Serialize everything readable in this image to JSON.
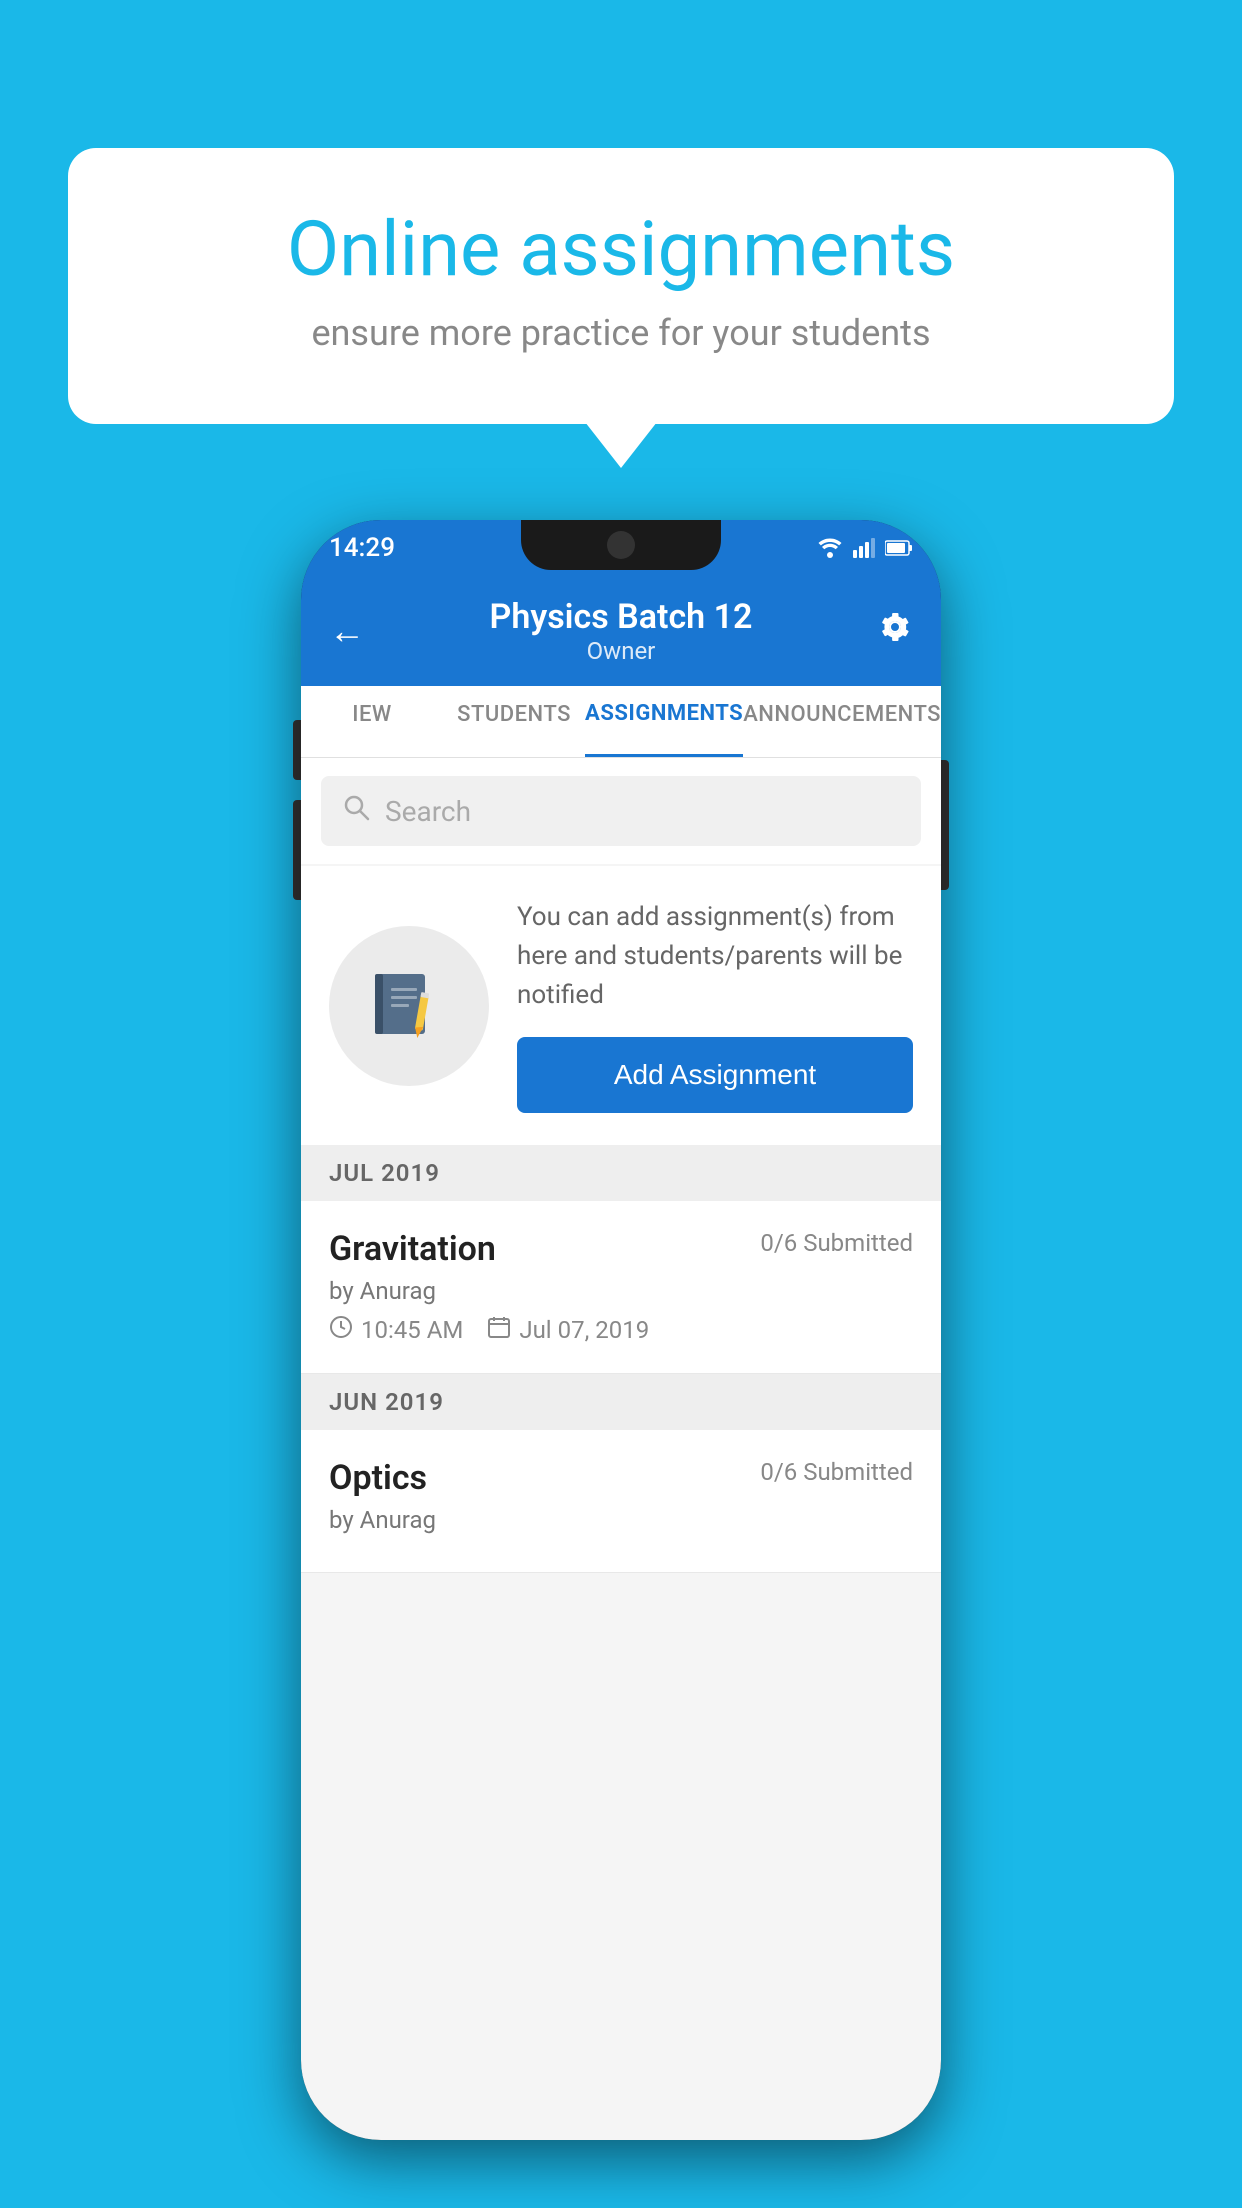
{
  "background": {
    "color": "#1ab8e8"
  },
  "speech_bubble": {
    "title": "Online assignments",
    "subtitle": "ensure more practice for your students"
  },
  "phone": {
    "status_bar": {
      "time": "14:29",
      "icons": [
        "wifi",
        "signal",
        "battery"
      ]
    },
    "header": {
      "title": "Physics Batch 12",
      "subtitle": "Owner",
      "back_label": "←",
      "settings_label": "⚙"
    },
    "tabs": [
      {
        "label": "IEW",
        "active": false
      },
      {
        "label": "STUDENTS",
        "active": false
      },
      {
        "label": "ASSIGNMENTS",
        "active": true
      },
      {
        "label": "ANNOUNCEMENTS",
        "active": false
      }
    ],
    "search": {
      "placeholder": "Search"
    },
    "add_assignment": {
      "description": "You can add assignment(s) from here and students/parents will be notified",
      "button_label": "Add Assignment"
    },
    "sections": [
      {
        "month_label": "JUL 2019",
        "assignments": [
          {
            "name": "Gravitation",
            "submitted": "0/6 Submitted",
            "by": "by Anurag",
            "time": "10:45 AM",
            "date": "Jul 07, 2019"
          }
        ]
      },
      {
        "month_label": "JUN 2019",
        "assignments": [
          {
            "name": "Optics",
            "submitted": "0/6 Submitted",
            "by": "by Anurag",
            "time": "",
            "date": ""
          }
        ]
      }
    ]
  }
}
